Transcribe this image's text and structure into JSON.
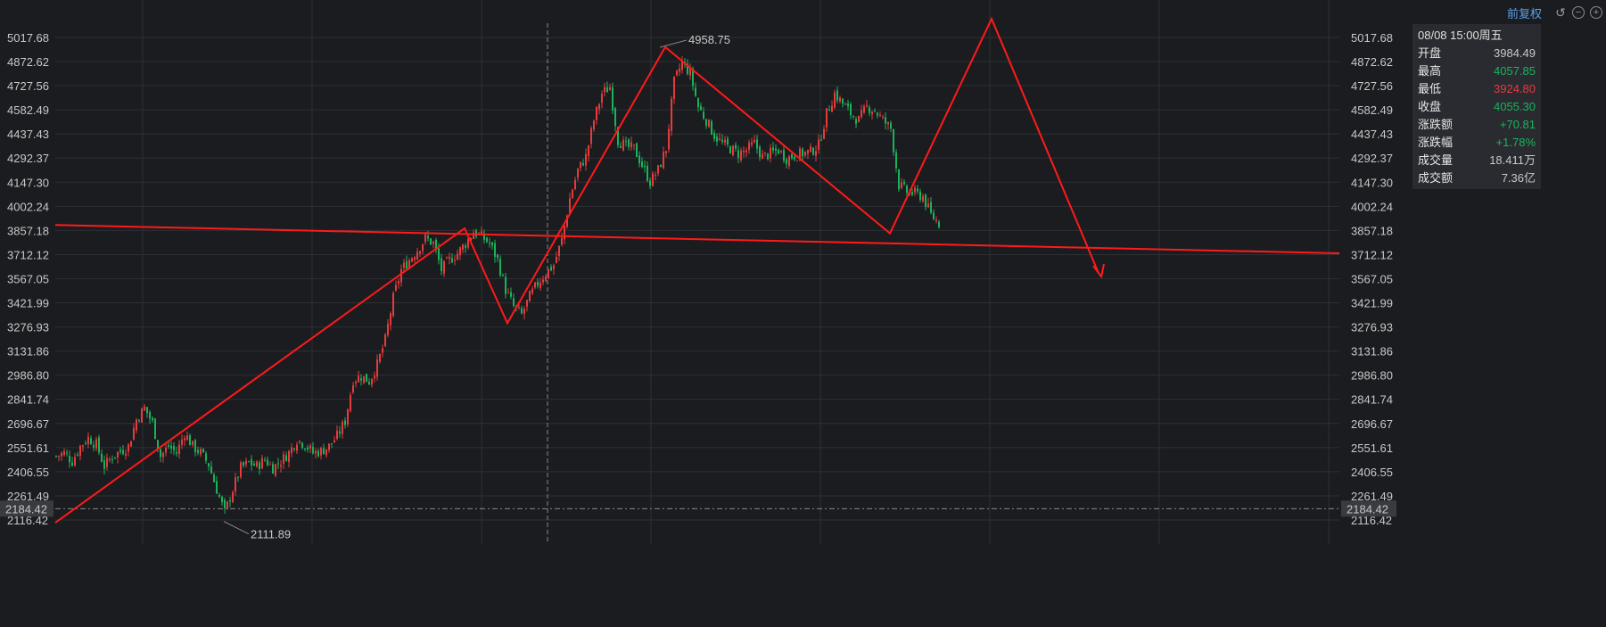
{
  "toolbar": {
    "adjust_label": "前复权",
    "icons": [
      "undo-icon",
      "zoom-out-icon",
      "zoom-in-icon"
    ]
  },
  "info_panel": {
    "header": "08/08 15:00周五",
    "rows": [
      {
        "label": "开盘",
        "value": "3984.49",
        "color": "plain"
      },
      {
        "label": "最高",
        "value": "4057.85",
        "color": "green"
      },
      {
        "label": "最低",
        "value": "3924.80",
        "color": "red"
      },
      {
        "label": "收盘",
        "value": "4055.30",
        "color": "green"
      },
      {
        "label": "涨跌额",
        "value": "+70.81",
        "color": "green"
      },
      {
        "label": "涨跌幅",
        "value": "+1.78%",
        "color": "green"
      },
      {
        "label": "成交量",
        "value": "18.411万",
        "color": "plain"
      },
      {
        "label": "成交额",
        "value": "7.36亿",
        "color": "plain"
      }
    ]
  },
  "chart_data": {
    "type": "candlestick",
    "y_ticks": [
      "5017.68",
      "4872.62",
      "4727.56",
      "4582.49",
      "4437.43",
      "4292.37",
      "4147.30",
      "4002.24",
      "3857.18",
      "3712.12",
      "3567.05",
      "3421.99",
      "3276.93",
      "3131.86",
      "2986.80",
      "2841.74",
      "2696.67",
      "2551.61",
      "2406.55",
      "2261.49",
      "2116.42"
    ],
    "ylim": [
      2116.42,
      5017.68
    ],
    "current_price_label": "2184.42",
    "high_label": "4958.75",
    "low_label": "2111.89",
    "colors": {
      "up": "#e53b3b",
      "down": "#19b35a",
      "annotation": "#ff1a1a",
      "grid": "#2e2f34"
    },
    "close_path": [
      [
        0,
        2500
      ],
      [
        3,
        2520
      ],
      [
        6,
        2470
      ],
      [
        9,
        2560
      ],
      [
        12,
        2610
      ],
      [
        15,
        2570
      ],
      [
        18,
        2440
      ],
      [
        21,
        2500
      ],
      [
        24,
        2530
      ],
      [
        27,
        2560
      ],
      [
        30,
        2720
      ],
      [
        33,
        2790
      ],
      [
        36,
        2700
      ],
      [
        39,
        2500
      ],
      [
        42,
        2560
      ],
      [
        45,
        2520
      ],
      [
        48,
        2640
      ],
      [
        51,
        2560
      ],
      [
        54,
        2520
      ],
      [
        57,
        2450
      ],
      [
        60,
        2300
      ],
      [
        63,
        2160
      ],
      [
        66,
        2300
      ],
      [
        69,
        2430
      ],
      [
        72,
        2460
      ],
      [
        75,
        2440
      ],
      [
        78,
        2480
      ],
      [
        81,
        2430
      ],
      [
        84,
        2470
      ],
      [
        87,
        2520
      ],
      [
        90,
        2600
      ],
      [
        93,
        2570
      ],
      [
        96,
        2520
      ],
      [
        99,
        2530
      ],
      [
        102,
        2560
      ],
      [
        105,
        2620
      ],
      [
        108,
        2710
      ],
      [
        111,
        2960
      ],
      [
        114,
        2980
      ],
      [
        117,
        2950
      ],
      [
        120,
        3050
      ],
      [
        123,
        3200
      ],
      [
        126,
        3450
      ],
      [
        129,
        3620
      ],
      [
        132,
        3680
      ],
      [
        135,
        3740
      ],
      [
        138,
        3810
      ],
      [
        141,
        3780
      ],
      [
        144,
        3620
      ],
      [
        147,
        3680
      ],
      [
        150,
        3720
      ],
      [
        153,
        3780
      ],
      [
        156,
        3850
      ],
      [
        159,
        3820
      ],
      [
        162,
        3780
      ],
      [
        165,
        3680
      ],
      [
        168,
        3500
      ],
      [
        171,
        3400
      ],
      [
        174,
        3350
      ],
      [
        177,
        3460
      ],
      [
        180,
        3540
      ],
      [
        183,
        3600
      ],
      [
        186,
        3650
      ],
      [
        189,
        3800
      ],
      [
        192,
        4050
      ],
      [
        195,
        4220
      ],
      [
        198,
        4300
      ],
      [
        201,
        4520
      ],
      [
        204,
        4680
      ],
      [
        207,
        4720
      ],
      [
        210,
        4400
      ],
      [
        213,
        4360
      ],
      [
        216,
        4350
      ],
      [
        219,
        4250
      ],
      [
        222,
        4150
      ],
      [
        225,
        4220
      ],
      [
        228,
        4350
      ],
      [
        231,
        4750
      ],
      [
        234,
        4870
      ],
      [
        237,
        4800
      ],
      [
        240,
        4600
      ],
      [
        243,
        4520
      ],
      [
        246,
        4430
      ],
      [
        249,
        4380
      ],
      [
        252,
        4350
      ],
      [
        255,
        4320
      ],
      [
        258,
        4340
      ],
      [
        261,
        4380
      ],
      [
        264,
        4300
      ],
      [
        267,
        4320
      ],
      [
        270,
        4340
      ],
      [
        273,
        4290
      ],
      [
        276,
        4310
      ],
      [
        279,
        4320
      ],
      [
        282,
        4330
      ],
      [
        285,
        4370
      ],
      [
        288,
        4560
      ],
      [
        291,
        4680
      ],
      [
        294,
        4620
      ],
      [
        297,
        4560
      ],
      [
        300,
        4520
      ],
      [
        303,
        4600
      ],
      [
        306,
        4580
      ],
      [
        309,
        4520
      ],
      [
        312,
        4470
      ],
      [
        315,
        4130
      ],
      [
        318,
        4090
      ],
      [
        321,
        4080
      ],
      [
        324,
        4060
      ],
      [
        327,
        3950
      ],
      [
        330,
        3900
      ]
    ],
    "annotations": {
      "zigzag": [
        [
          0,
          2100
        ],
        [
          153,
          3870
        ],
        [
          169,
          3300
        ],
        [
          228,
          4960
        ],
        [
          312,
          3840
        ],
        [
          350,
          5130
        ],
        [
          390,
          3600
        ]
      ],
      "arrow_head_target": [
        391,
        3580
      ],
      "neckline": [
        [
          0,
          3890
        ],
        [
          480,
          3720
        ]
      ]
    }
  }
}
